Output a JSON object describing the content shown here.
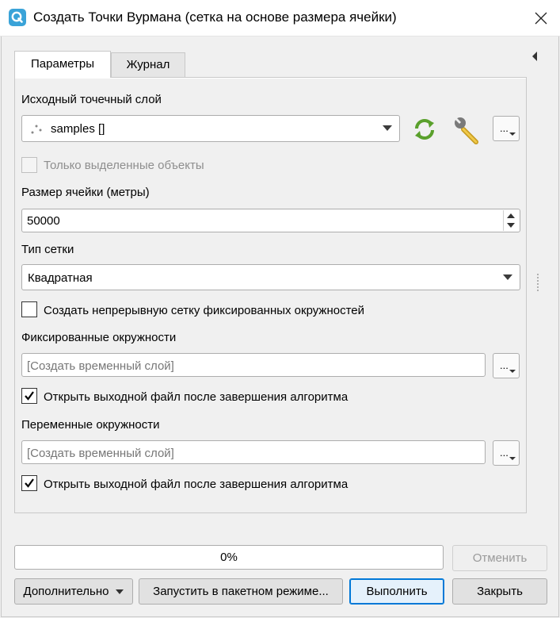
{
  "window": {
    "title": "Создать Точки Вурмана (сетка на основе размера ячейки)",
    "app_icon": "qgis-icon",
    "close_icon": "close-icon"
  },
  "tabs": [
    {
      "label": "Параметры",
      "active": true
    },
    {
      "label": "Журнал",
      "active": false
    }
  ],
  "params": {
    "input_layer_label": "Исходный точечный слой",
    "input_layer_value": "samples []",
    "input_layer_icon": "point-layer-icon",
    "selected_only_label": "Только выделенные объекты",
    "selected_only_checked": false,
    "cell_size_label": "Размер ячейки (метры)",
    "cell_size_value": "50000",
    "grid_type_label": "Тип сетки",
    "grid_type_value": "Квадратная",
    "continuous_grid_label": "Создать непрерывную сетку фиксированных окружностей",
    "continuous_grid_checked": false,
    "fixed_circles_label": "Фиксированные окружности",
    "fixed_circles_placeholder": "[Создать временный слой]",
    "open_output_1_label": "Открыть выходной файл после завершения алгоритма",
    "open_output_1_checked": true,
    "variable_circles_label": "Переменные окружности",
    "variable_circles_placeholder": "[Создать временный слой]",
    "open_output_2_label": "Открыть выходной файл после завершения алгоритма",
    "open_output_2_checked": true,
    "dots_label": "..."
  },
  "footer": {
    "progress_text": "0%",
    "progress_value": 0,
    "cancel_label": "Отменить",
    "advanced_label": "Дополнительно",
    "batch_label": "Запустить в пакетном режиме...",
    "run_label": "Выполнить",
    "close_label": "Закрыть"
  },
  "colors": {
    "accent": "#0078d7",
    "iterate_icon": "#5aa02c",
    "qgis_icon": "#3aa3d8"
  }
}
